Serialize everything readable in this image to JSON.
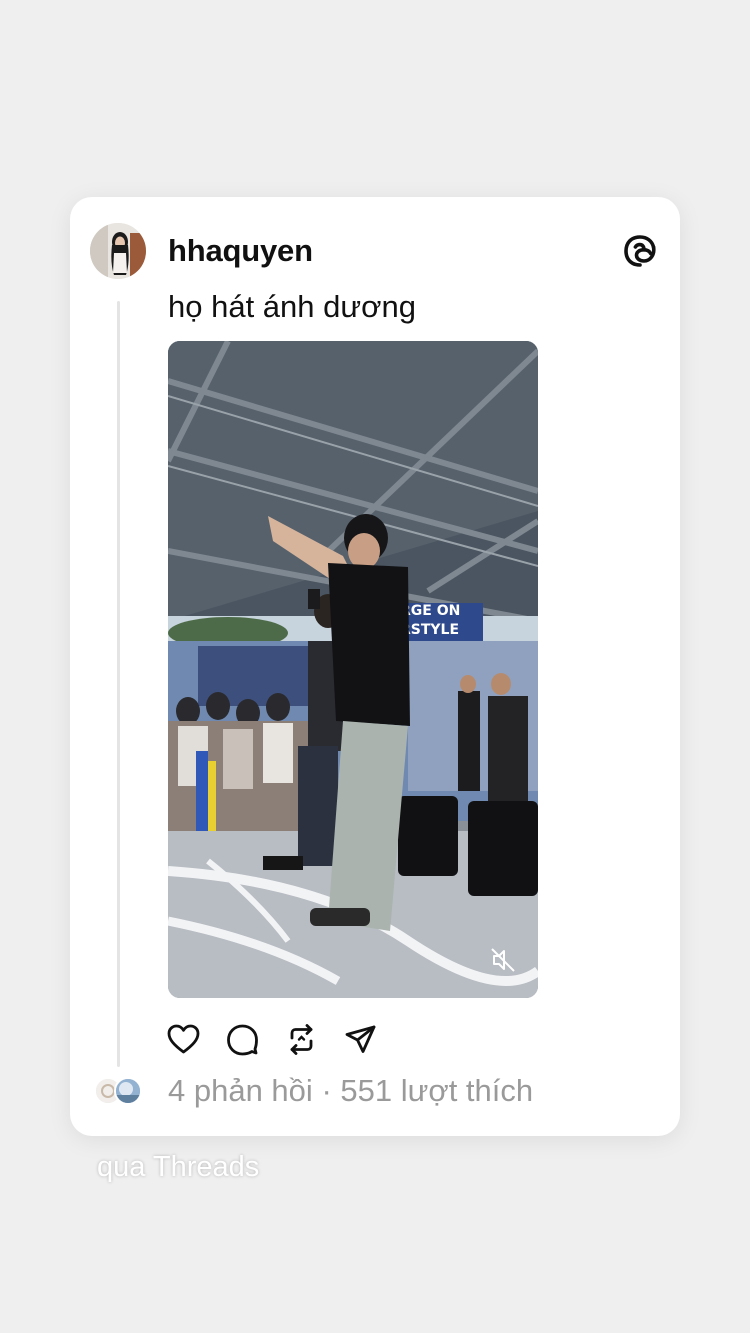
{
  "post": {
    "username": "hhaquyen",
    "text": "họ hát ánh dương",
    "avatar_icon": "profile-photo",
    "media": {
      "type": "video",
      "signs": [
        "RGE ON",
        "RSTYLE"
      ],
      "muted_icon": "speaker-muted-icon"
    },
    "actions": [
      "heart-icon",
      "comment-icon",
      "repost-icon",
      "share-icon"
    ],
    "stats": {
      "replies": "4 phản hồi",
      "separator": "·",
      "likes": "551 lượt thích"
    }
  },
  "footer": {
    "via": "qua Threads"
  },
  "colors": {
    "background": "#efefef",
    "card": "#ffffff",
    "text": "#111111",
    "muted": "#9a9a9a"
  }
}
